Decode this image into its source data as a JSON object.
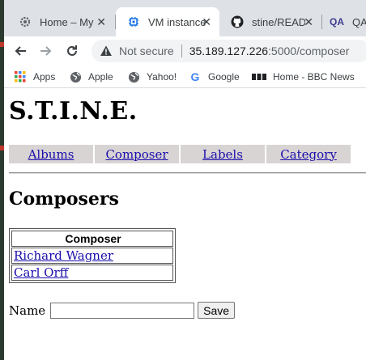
{
  "browser": {
    "tabs": [
      {
        "label": "Home – My",
        "icon": "gear-icon",
        "active": false
      },
      {
        "label": "VM instance",
        "icon": "chip-icon",
        "active": true
      },
      {
        "label": "stine/READM",
        "icon": "github-icon",
        "active": false
      },
      {
        "label": "QA",
        "icon": "qa-icon",
        "active": false
      }
    ],
    "close_glyph": "✕",
    "security_label": "Not secure",
    "url_host": "35.189.127.226",
    "url_rest": ":5000/composer",
    "bookmarks": [
      {
        "label": "Apps",
        "icon": "apps-grid-icon"
      },
      {
        "label": "Apple",
        "icon": "globe-icon"
      },
      {
        "label": "Yahoo!",
        "icon": "globe-icon"
      },
      {
        "label": "Google",
        "icon": "google-icon"
      },
      {
        "label": "Home - BBC News",
        "icon": "bbc-icon"
      }
    ]
  },
  "page": {
    "site_title": "S.T.I.N.E.",
    "nav": [
      "Albums",
      "Composer",
      "Labels",
      "Category"
    ],
    "section_title": "Composers",
    "table": {
      "header": "Composer",
      "rows": [
        "Richard Wagner",
        "Carl Orff"
      ]
    },
    "form": {
      "label": "Name",
      "value": "",
      "save_label": "Save"
    }
  }
}
